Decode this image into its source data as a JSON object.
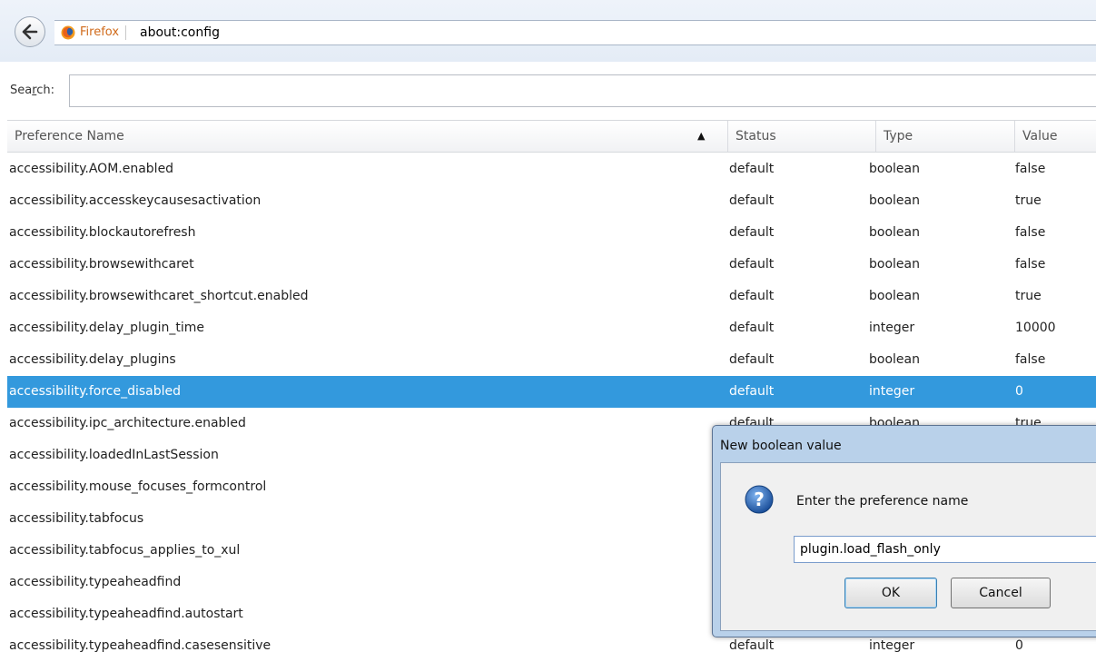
{
  "browser": {
    "identity_label": "Firefox",
    "url": "about:config"
  },
  "search": {
    "label_prefix": "Sea",
    "label_underlined": "r",
    "label_suffix": "ch:",
    "value": ""
  },
  "table": {
    "columns": [
      "Preference Name",
      "Status",
      "Type",
      "Value"
    ],
    "rows": [
      {
        "name": "accessibility.AOM.enabled",
        "status": "default",
        "type": "boolean",
        "value": "false"
      },
      {
        "name": "accessibility.accesskeycausesactivation",
        "status": "default",
        "type": "boolean",
        "value": "true"
      },
      {
        "name": "accessibility.blockautorefresh",
        "status": "default",
        "type": "boolean",
        "value": "false"
      },
      {
        "name": "accessibility.browsewithcaret",
        "status": "default",
        "type": "boolean",
        "value": "false"
      },
      {
        "name": "accessibility.browsewithcaret_shortcut.enabled",
        "status": "default",
        "type": "boolean",
        "value": "true"
      },
      {
        "name": "accessibility.delay_plugin_time",
        "status": "default",
        "type": "integer",
        "value": "10000"
      },
      {
        "name": "accessibility.delay_plugins",
        "status": "default",
        "type": "boolean",
        "value": "false"
      },
      {
        "name": "accessibility.force_disabled",
        "status": "default",
        "type": "integer",
        "value": "0",
        "selected": true
      },
      {
        "name": "accessibility.ipc_architecture.enabled",
        "status": "default",
        "type": "boolean",
        "value": "true"
      },
      {
        "name": "accessibility.loadedInLastSession",
        "status": "",
        "type": "",
        "value": ""
      },
      {
        "name": "accessibility.mouse_focuses_formcontrol",
        "status": "",
        "type": "",
        "value": ""
      },
      {
        "name": "accessibility.tabfocus",
        "status": "",
        "type": "",
        "value": ""
      },
      {
        "name": "accessibility.tabfocus_applies_to_xul",
        "status": "",
        "type": "",
        "value": ""
      },
      {
        "name": "accessibility.typeaheadfind",
        "status": "",
        "type": "",
        "value": ""
      },
      {
        "name": "accessibility.typeaheadfind.autostart",
        "status": "",
        "type": "",
        "value": ""
      },
      {
        "name": "accessibility.typeaheadfind.casesensitive",
        "status": "default",
        "type": "integer",
        "value": "0"
      }
    ]
  },
  "dialog": {
    "title": "New boolean value",
    "prompt": "Enter the preference name",
    "input_value": "plugin.load_flash_only",
    "ok_label": "OK",
    "cancel_label": "Cancel"
  },
  "colors": {
    "selection": "#3399dd",
    "dialog_frame": "#b9d1ea",
    "identity": "#d06a1a"
  },
  "icons": [
    "back-arrow-icon",
    "firefox-logo-icon",
    "sort-ascending-icon",
    "question-icon"
  ]
}
